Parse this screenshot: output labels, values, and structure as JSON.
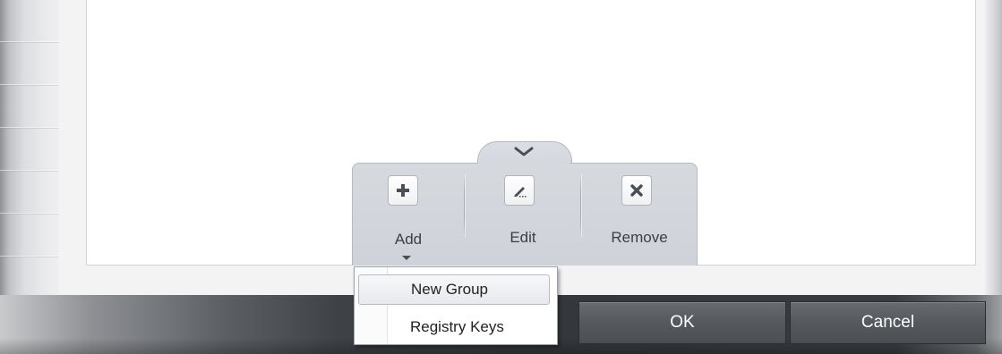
{
  "toolbar": {
    "collapse_icon": "chevron-down-icon",
    "add": {
      "label": "Add",
      "icon": "plus-icon"
    },
    "edit": {
      "label": "Edit",
      "icon": "pencil-icon"
    },
    "remove": {
      "label": "Remove",
      "icon": "x-icon"
    }
  },
  "add_menu": {
    "items": [
      {
        "label": "New Group",
        "highlighted": true
      },
      {
        "label": "Registry Keys",
        "highlighted": false
      }
    ]
  },
  "dialog_buttons": {
    "ok_label": "OK",
    "cancel_label": "Cancel"
  },
  "colors": {
    "icon": "#4b4e54",
    "bottom_bar": "#34373c",
    "button": "#55585d"
  }
}
